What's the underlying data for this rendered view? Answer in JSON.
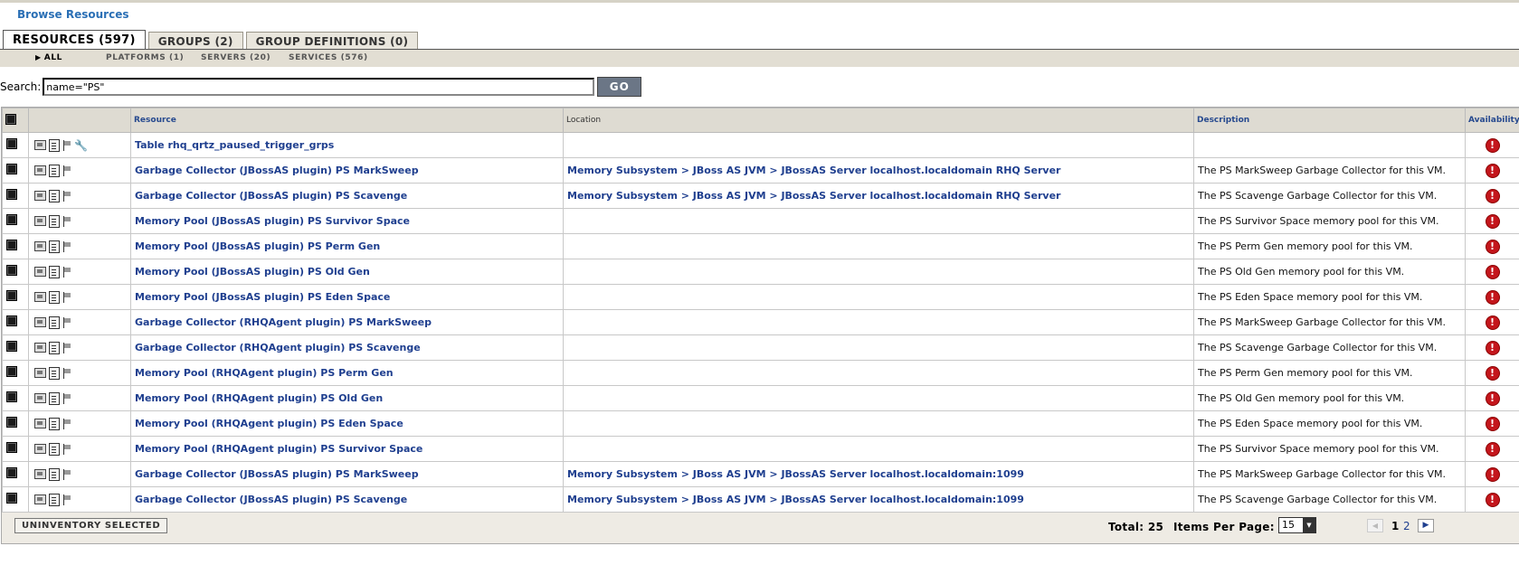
{
  "page": {
    "title": "Browse Resources"
  },
  "tabs": [
    {
      "label": "RESOURCES (597)",
      "active": true
    },
    {
      "label": "GROUPS (2)",
      "active": false
    },
    {
      "label": "GROUP DEFINITIONS (0)",
      "active": false
    }
  ],
  "subtabs": [
    {
      "label": "ALL",
      "active": true
    },
    {
      "label": "PLATFORMS (1)",
      "active": false
    },
    {
      "label": "SERVERS (20)",
      "active": false
    },
    {
      "label": "SERVICES (576)",
      "active": false
    }
  ],
  "search": {
    "label": "Search:",
    "value": "name=\"PS\"",
    "go_label": "GO"
  },
  "table": {
    "headers": {
      "resource": "Resource",
      "location": "Location",
      "description": "Description",
      "availability": "Availability"
    },
    "rows": [
      {
        "resource": "Table rhq_qrtz_paused_trigger_grps",
        "location": "",
        "description": "",
        "has_wrench": true
      },
      {
        "resource": "Garbage Collector (JBossAS plugin) PS MarkSweep",
        "location": "Memory Subsystem > JBoss AS JVM > JBossAS Server localhost.localdomain RHQ Server",
        "description": "The PS MarkSweep Garbage Collector for this VM."
      },
      {
        "resource": "Garbage Collector (JBossAS plugin) PS Scavenge",
        "location": "Memory Subsystem > JBoss AS JVM > JBossAS Server localhost.localdomain RHQ Server",
        "description": "The PS Scavenge Garbage Collector for this VM."
      },
      {
        "resource": "Memory Pool (JBossAS plugin) PS Survivor Space",
        "location": "",
        "description": "The PS Survivor Space memory pool for this VM."
      },
      {
        "resource": "Memory Pool (JBossAS plugin) PS Perm Gen",
        "location": "",
        "description": "The PS Perm Gen memory pool for this VM."
      },
      {
        "resource": "Memory Pool (JBossAS plugin) PS Old Gen",
        "location": "",
        "description": "The PS Old Gen memory pool for this VM."
      },
      {
        "resource": "Memory Pool (JBossAS plugin) PS Eden Space",
        "location": "",
        "description": "The PS Eden Space memory pool for this VM."
      },
      {
        "resource": "Garbage Collector (RHQAgent plugin) PS MarkSweep",
        "location": "",
        "description": "The PS MarkSweep Garbage Collector for this VM."
      },
      {
        "resource": "Garbage Collector (RHQAgent plugin) PS Scavenge",
        "location": "",
        "description": "The PS Scavenge Garbage Collector for this VM."
      },
      {
        "resource": "Memory Pool (RHQAgent plugin) PS Perm Gen",
        "location": "",
        "description": "The PS Perm Gen memory pool for this VM."
      },
      {
        "resource": "Memory Pool (RHQAgent plugin) PS Old Gen",
        "location": "",
        "description": "The PS Old Gen memory pool for this VM."
      },
      {
        "resource": "Memory Pool (RHQAgent plugin) PS Eden Space",
        "location": "",
        "description": "The PS Eden Space memory pool for this VM."
      },
      {
        "resource": "Memory Pool (RHQAgent plugin) PS Survivor Space",
        "location": "",
        "description": "The PS Survivor Space memory pool for this VM."
      },
      {
        "resource": "Garbage Collector (JBossAS plugin) PS MarkSweep",
        "location": "Memory Subsystem > JBoss AS JVM > JBossAS Server localhost.localdomain:1099",
        "description": "The PS MarkSweep Garbage Collector for this VM."
      },
      {
        "resource": "Garbage Collector (JBossAS plugin) PS Scavenge",
        "location": "Memory Subsystem > JBoss AS JVM > JBossAS Server localhost.localdomain:1099",
        "description": "The PS Scavenge Garbage Collector for this VM."
      }
    ]
  },
  "footer": {
    "uninventory_label": "UNINVENTORY SELECTED",
    "total_label": "Total: 25",
    "items_per_page_label": "Items Per Page:",
    "items_per_page_value": "15",
    "current_page": "1",
    "next_page": "2"
  },
  "colors": {
    "link": "#1f3f8f",
    "title": "#2a6fb5",
    "availability_down": "#c4161c"
  }
}
